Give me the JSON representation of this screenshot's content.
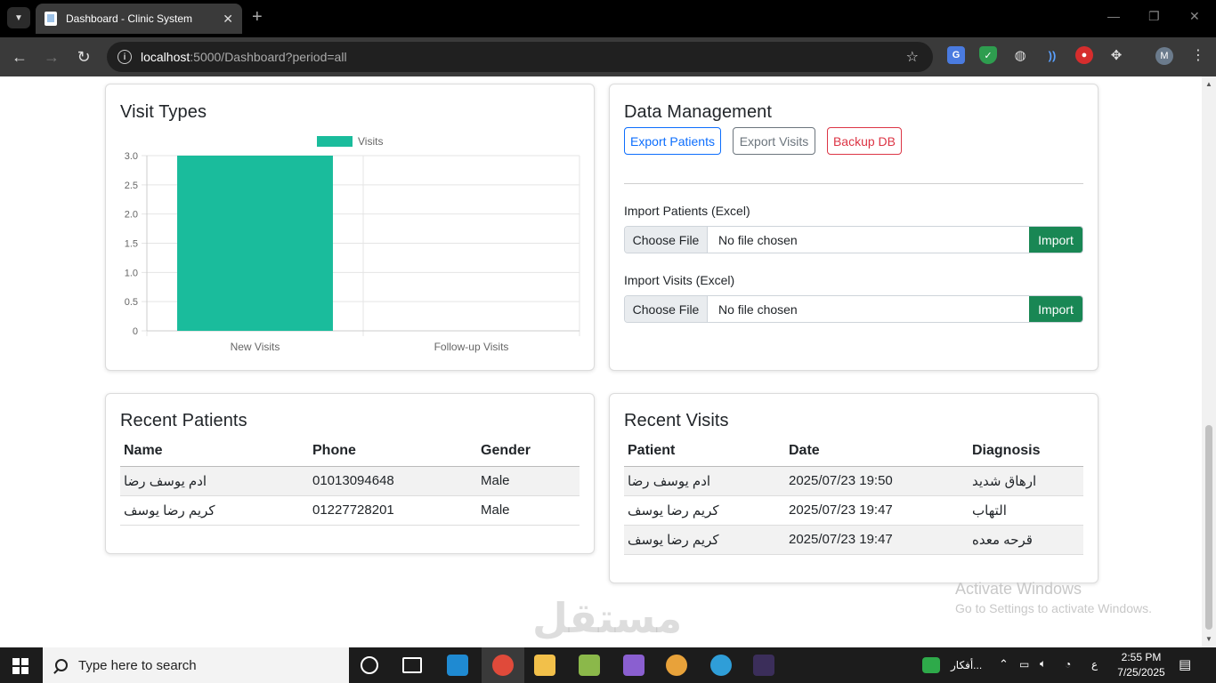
{
  "browser": {
    "tab_title": "Dashboard - Clinic System",
    "url_host": "localhost",
    "url_rest": ":5000/Dashboard?period=all"
  },
  "visit_types": {
    "title": "Visit Types"
  },
  "chart_data": {
    "type": "bar",
    "categories": [
      "New Visits",
      "Follow-up Visits"
    ],
    "series": [
      {
        "name": "Visits",
        "values": [
          3,
          0
        ],
        "color": "#1abc9c"
      }
    ],
    "ylim": [
      0,
      3
    ],
    "yticks": [
      "3.0",
      "2.5",
      "2.0",
      "1.5",
      "1.0",
      "0.5",
      "0"
    ],
    "legend": "top",
    "grid": true
  },
  "data_management": {
    "title": "Data Management",
    "export_patients": "Export Patients",
    "export_visits": "Export Visits",
    "backup_db": "Backup DB",
    "import_patients_label": "Import Patients (Excel)",
    "import_visits_label": "Import Visits (Excel)",
    "choose_file": "Choose File",
    "no_file": "No file chosen",
    "import": "Import"
  },
  "recent_patients": {
    "title": "Recent Patients",
    "headers": [
      "Name",
      "Phone",
      "Gender"
    ],
    "rows": [
      [
        "ادم يوسف رضا",
        "01013094648",
        "Male"
      ],
      [
        "كريم رضا يوسف",
        "01227728201",
        "Male"
      ]
    ]
  },
  "recent_visits": {
    "title": "Recent Visits",
    "headers": [
      "Patient",
      "Date",
      "Diagnosis"
    ],
    "rows": [
      [
        "ادم يوسف رضا",
        "2025/07/23 19:50",
        "ارهاق شديد"
      ],
      [
        "كريم رضا يوسف",
        "2025/07/23 19:47",
        "التهاب"
      ],
      [
        "كريم رضا يوسف",
        "2025/07/23 19:47",
        "قرحه معده"
      ]
    ]
  },
  "watermark": {
    "title": "Activate Windows",
    "subtitle": "Go to Settings to activate Windows.",
    "site": "مستقل"
  },
  "taskbar": {
    "search_placeholder": "Type here to search",
    "tray_label": "أفكار...",
    "lang": "ع",
    "time": "2:55 PM",
    "date": "7/25/2025"
  }
}
